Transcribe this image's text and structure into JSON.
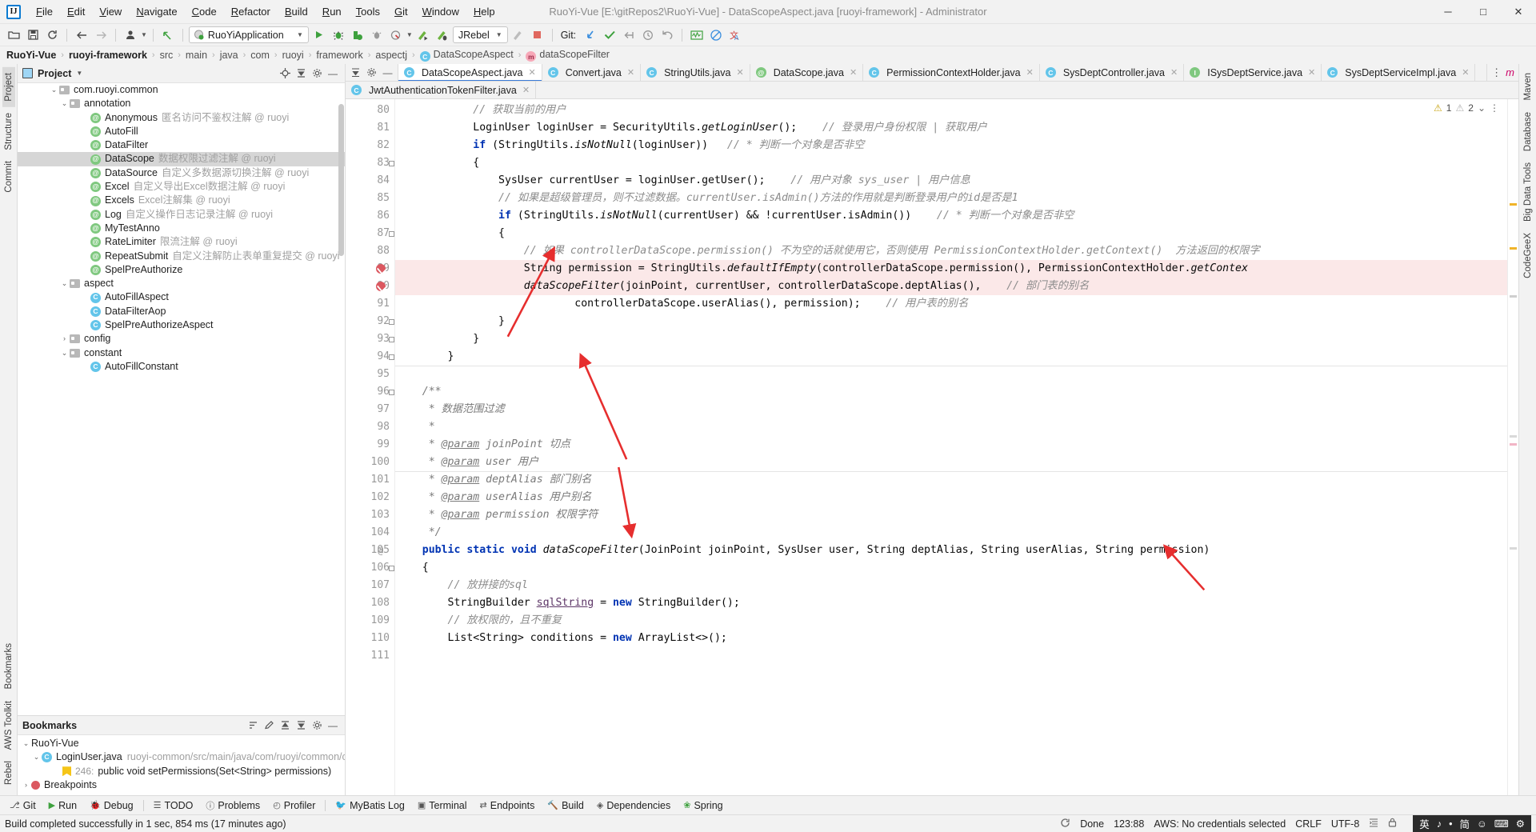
{
  "window": {
    "title": "RuoYi-Vue [E:\\gitRepos2\\RuoYi-Vue] - DataScopeAspect.java [ruoyi-framework] - Administrator",
    "minimize": "─",
    "maximize": "□",
    "close": "✕"
  },
  "menu": [
    "File",
    "Edit",
    "View",
    "Navigate",
    "Code",
    "Refactor",
    "Build",
    "Run",
    "Tools",
    "Git",
    "Window",
    "Help"
  ],
  "toolbar": {
    "open_label": "open-folder-icon",
    "save_label": "save-icon",
    "sync_label": "sync-icon",
    "back_label": "back-arrow-icon",
    "forward_label": "forward-arrow-icon",
    "profile_label": "user-icon",
    "undo_label": "undo-icon",
    "run_config": "RuoYiApplication",
    "run_label": "run-icon",
    "debug_label": "debug-icon",
    "run_coverage_label": "run-with-coverage-icon",
    "profiler_label": "profiler-icon",
    "attach_label": "attach-icon",
    "jrebel_run": "jrebel-run-icon",
    "jrebel_debug": "jrebel-debug-icon",
    "jrebel": "JRebel",
    "stop_label": "stop-icon",
    "git_label": "Git:",
    "git_update": "git-update-icon",
    "git_commit": "git-commit-icon",
    "git_push": "git-push-icon",
    "git_history": "git-history-icon",
    "git_rollback": "git-rollback-icon",
    "search_everywhere": "search-icon",
    "settings": "gear-icon",
    "translate": "translate-icon",
    "inspect": "inspect-icon",
    "layout": "layout-icon"
  },
  "breadcrumb": [
    {
      "label": "RuoYi-Vue",
      "bold": true,
      "icon": null
    },
    {
      "label": "ruoyi-framework",
      "bold": true,
      "icon": null
    },
    {
      "label": "src",
      "bold": false,
      "icon": null
    },
    {
      "label": "main",
      "bold": false,
      "icon": null
    },
    {
      "label": "java",
      "bold": false,
      "icon": null
    },
    {
      "label": "com",
      "bold": false,
      "icon": null
    },
    {
      "label": "ruoyi",
      "bold": false,
      "icon": null
    },
    {
      "label": "framework",
      "bold": false,
      "icon": null
    },
    {
      "label": "aspectj",
      "bold": false,
      "icon": null
    },
    {
      "label": "DataScopeAspect",
      "bold": false,
      "icon": "class"
    },
    {
      "label": "dataScopeFilter",
      "bold": false,
      "icon": "method"
    }
  ],
  "left_strip": [
    {
      "label": "Project",
      "selected": true
    },
    {
      "label": "Structure",
      "selected": false
    },
    {
      "label": "Commit",
      "selected": false
    }
  ],
  "left_strip_bottom": [
    {
      "label": "Bookmarks"
    },
    {
      "label": "AWS Toolkit"
    },
    {
      "label": "Rebel"
    }
  ],
  "right_strip": [
    {
      "label": "Maven"
    },
    {
      "label": "Database"
    },
    {
      "label": "Big Data Tools"
    },
    {
      "label": "CodeGeeX"
    }
  ],
  "project_panel": {
    "title": "Project",
    "title_icon": "project-icon",
    "actions": [
      "locate-icon",
      "collapse-all-icon",
      "settings-icon",
      "hide-icon"
    ],
    "tree": [
      {
        "indent": 3,
        "arrow": "down",
        "icon": "folder",
        "name": "com.ruoyi.common",
        "desc": "",
        "selected": false
      },
      {
        "indent": 4,
        "arrow": "down",
        "icon": "folder",
        "name": "annotation",
        "desc": "",
        "selected": false
      },
      {
        "indent": 6,
        "arrow": "none",
        "icon": "ann",
        "name": "Anonymous",
        "desc": "匿名访问不鉴权注解 @ ruoyi",
        "selected": false
      },
      {
        "indent": 6,
        "arrow": "none",
        "icon": "ann",
        "name": "AutoFill",
        "desc": "",
        "selected": false
      },
      {
        "indent": 6,
        "arrow": "none",
        "icon": "ann",
        "name": "DataFilter",
        "desc": "",
        "selected": false
      },
      {
        "indent": 6,
        "arrow": "none",
        "icon": "ann",
        "name": "DataScope",
        "desc": "数据权限过滤注解 @ ruoyi",
        "selected": true
      },
      {
        "indent": 6,
        "arrow": "none",
        "icon": "ann",
        "name": "DataSource",
        "desc": "自定义多数据源切换注解 @ ruoyi",
        "selected": false
      },
      {
        "indent": 6,
        "arrow": "none",
        "icon": "ann",
        "name": "Excel",
        "desc": "自定义导出Excel数据注解 @ ruoyi",
        "selected": false
      },
      {
        "indent": 6,
        "arrow": "none",
        "icon": "ann",
        "name": "Excels",
        "desc": "Excel注解集 @ ruoyi",
        "selected": false
      },
      {
        "indent": 6,
        "arrow": "none",
        "icon": "ann",
        "name": "Log",
        "desc": "自定义操作日志记录注解 @ ruoyi",
        "selected": false
      },
      {
        "indent": 6,
        "arrow": "none",
        "icon": "ann",
        "name": "MyTestAnno",
        "desc": "",
        "selected": false
      },
      {
        "indent": 6,
        "arrow": "none",
        "icon": "ann",
        "name": "RateLimiter",
        "desc": "限流注解 @ ruoyi",
        "selected": false
      },
      {
        "indent": 6,
        "arrow": "none",
        "icon": "ann",
        "name": "RepeatSubmit",
        "desc": "自定义注解防止表单重复提交 @ ruoyi",
        "selected": false
      },
      {
        "indent": 6,
        "arrow": "none",
        "icon": "ann",
        "name": "SpelPreAuthorize",
        "desc": "",
        "selected": false
      },
      {
        "indent": 4,
        "arrow": "down",
        "icon": "folder",
        "name": "aspect",
        "desc": "",
        "selected": false
      },
      {
        "indent": 6,
        "arrow": "none",
        "icon": "class",
        "name": "AutoFillAspect",
        "desc": "",
        "selected": false
      },
      {
        "indent": 6,
        "arrow": "none",
        "icon": "class",
        "name": "DataFilterAop",
        "desc": "",
        "selected": false
      },
      {
        "indent": 6,
        "arrow": "none",
        "icon": "class",
        "name": "SpelPreAuthorizeAspect",
        "desc": "",
        "selected": false
      },
      {
        "indent": 4,
        "arrow": "right",
        "icon": "folder",
        "name": "config",
        "desc": "",
        "selected": false
      },
      {
        "indent": 4,
        "arrow": "down",
        "icon": "folder",
        "name": "constant",
        "desc": "",
        "selected": false
      },
      {
        "indent": 6,
        "arrow": "none",
        "icon": "class",
        "name": "AutoFillConstant",
        "desc": "",
        "selected": false
      }
    ]
  },
  "bookmarks_panel": {
    "title": "Bookmarks",
    "actions": [
      "sort-icon",
      "edit-icon",
      "expand-all-icon",
      "collapse-all-icon",
      "settings-icon",
      "hide-icon"
    ],
    "rows": [
      {
        "indent": 0,
        "arrow": "down",
        "icon": "none",
        "name": "RuoYi-Vue",
        "desc": "",
        "num": ""
      },
      {
        "indent": 1,
        "arrow": "down",
        "icon": "class",
        "name": "LoginUser.java",
        "desc": "ruoyi-common/src/main/java/com/ruoyi/common/core/do",
        "num": ""
      },
      {
        "indent": 3,
        "arrow": "none",
        "icon": "bookmark",
        "name": "public void setPermissions(Set<String> permissions)",
        "desc": "",
        "num": "246:"
      },
      {
        "indent": 0,
        "arrow": "right",
        "icon": "breakpoint",
        "name": "Breakpoints",
        "desc": "",
        "num": ""
      }
    ]
  },
  "editor_tabs": [
    {
      "label": "DataScopeAspect.java",
      "icon": "class",
      "active": true
    },
    {
      "label": "Convert.java",
      "icon": "class",
      "active": false
    },
    {
      "label": "StringUtils.java",
      "icon": "class",
      "active": false
    },
    {
      "label": "DataScope.java",
      "icon": "ann",
      "active": false
    },
    {
      "label": "PermissionContextHolder.java",
      "icon": "class",
      "active": false
    },
    {
      "label": "SysDeptController.java",
      "icon": "class",
      "active": false
    },
    {
      "label": "ISysDeptService.java",
      "icon": "iface",
      "active": false
    },
    {
      "label": "SysDeptServiceImpl.java",
      "icon": "class",
      "active": false
    }
  ],
  "editor_tabs_row2": [
    {
      "label": "JwtAuthenticationTokenFilter.java",
      "icon": "class",
      "active": false
    }
  ],
  "inspection": {
    "warnings_icon": "warning-icon",
    "warnings": "1",
    "weak_icon": "weak-warning-icon",
    "weak": "2",
    "chevron": "⌄",
    "more": "⋮"
  },
  "editor": {
    "first_line": 80,
    "lines": [
      {
        "n": 80,
        "html": "            <span class='cm'>// 获取当前的用户</span>",
        "bp": false,
        "fold": false,
        "hl": false,
        "at": false
      },
      {
        "n": 81,
        "html": "            LoginUser loginUser = SecurityUtils.<span class='mthi'>getLoginUser</span>();    <span class='cm'>// 登录用户身份权限 | 获取用户</span>",
        "bp": false,
        "fold": false,
        "hl": false,
        "at": false
      },
      {
        "n": 82,
        "html": "            <span class='kw'>if</span> (StringUtils.<span class='mthi'>isNotNull</span>(loginUser))   <span class='cm'>// * 判断一个对象是否非空</span>",
        "bp": false,
        "fold": false,
        "hl": false,
        "at": false
      },
      {
        "n": 83,
        "html": "            {",
        "bp": false,
        "fold": true,
        "hl": false,
        "at": false
      },
      {
        "n": 84,
        "html": "                SysUser currentUser = loginUser.getUser();    <span class='cm'>// 用户对象 sys_user | 用户信息</span>",
        "bp": false,
        "fold": false,
        "hl": false,
        "at": false
      },
      {
        "n": 85,
        "html": "                <span class='cm'>// 如果是超级管理员，则不过滤数据。currentUser.isAdmin()方法的作用就是判断登录用户的id是否是1</span>",
        "bp": false,
        "fold": false,
        "hl": false,
        "at": false
      },
      {
        "n": 86,
        "html": "                <span class='kw'>if</span> (StringUtils.<span class='mthi'>isNotNull</span>(currentUser) &amp;&amp; !currentUser.isAdmin())    <span class='cm'>// * 判断一个对象是否非空</span>",
        "bp": false,
        "fold": false,
        "hl": false,
        "at": false
      },
      {
        "n": 87,
        "html": "                {",
        "bp": false,
        "fold": true,
        "hl": false,
        "at": false
      },
      {
        "n": 88,
        "html": "                    <span class='cm'>// 如果 controllerDataScope.permission() 不为空的话就使用它，否则使用 PermissionContextHolder.getContext()  方法返回的权限字</span>",
        "bp": false,
        "fold": false,
        "hl": false,
        "at": false
      },
      {
        "n": 89,
        "html": "                    String permission = StringUtils.<span class='mthi'>defaultIfEmpty</span>(controllerDataScope.permission(), PermissionContextHolder.<span class='mthi'>getContex</span>",
        "bp": true,
        "fold": false,
        "hl": true,
        "at": false
      },
      {
        "n": 90,
        "html": "                    <span class='mthi'>dataScopeFilter</span>(joinPoint, currentUser, controllerDataScope.deptAlias(),    <span class='cm'>// 部门表的别名</span>",
        "bp": true,
        "fold": false,
        "hl": true,
        "at": false
      },
      {
        "n": 91,
        "html": "                            controllerDataScope.userAlias(), permission);    <span class='cm'>// 用户表的别名</span>",
        "bp": false,
        "fold": false,
        "hl": false,
        "at": false
      },
      {
        "n": 92,
        "html": "                }",
        "bp": false,
        "fold": true,
        "hl": false,
        "at": false
      },
      {
        "n": 93,
        "html": "            }",
        "bp": false,
        "fold": true,
        "hl": false,
        "at": false
      },
      {
        "n": 94,
        "html": "        }",
        "bp": false,
        "fold": true,
        "hl": false,
        "at": false
      },
      {
        "n": 95,
        "html": "",
        "bp": false,
        "fold": false,
        "hl": false,
        "at": false
      },
      {
        "n": 96,
        "html": "    <span class='jd'>/**</span>",
        "bp": false,
        "fold": true,
        "hl": false,
        "at": false
      },
      {
        "n": 97,
        "html": "     <span class='jd'>* 数据范围过滤</span>",
        "bp": false,
        "fold": false,
        "hl": false,
        "at": false
      },
      {
        "n": 98,
        "html": "     <span class='jd'>*</span>",
        "bp": false,
        "fold": false,
        "hl": false,
        "at": false
      },
      {
        "n": 99,
        "html": "     <span class='jd'>* <span class='jdtag'>@param</span> joinPoint 切点</span>",
        "bp": false,
        "fold": false,
        "hl": false,
        "at": false
      },
      {
        "n": 100,
        "html": "     <span class='jd'>* <span class='jdtag'>@param</span> user 用户</span>",
        "bp": false,
        "fold": false,
        "hl": false,
        "at": false
      },
      {
        "n": 101,
        "html": "     <span class='jd'>* <span class='jdtag'>@param</span> deptAlias 部门别名</span>",
        "bp": false,
        "fold": false,
        "hl": false,
        "at": false
      },
      {
        "n": 102,
        "html": "     <span class='jd'>* <span class='jdtag'>@param</span> userAlias 用户别名</span>",
        "bp": false,
        "fold": false,
        "hl": false,
        "at": false
      },
      {
        "n": 103,
        "html": "     <span class='jd'>* <span class='jdtag'>@param</span> permission 权限字符</span>",
        "bp": false,
        "fold": false,
        "hl": false,
        "at": false
      },
      {
        "n": 104,
        "html": "     <span class='jd'>*/</span>",
        "bp": false,
        "fold": false,
        "hl": false,
        "at": false
      },
      {
        "n": 105,
        "html": "    <span class='kw'>public</span> <span class='kw'>static</span> <span class='kw'>void</span> <span class='mthi'>dataScopeFilter</span>(JoinPoint joinPoint, SysUser user, String deptAlias, String userAlias, String permission)",
        "bp": false,
        "fold": false,
        "hl": false,
        "at": true
      },
      {
        "n": 106,
        "html": "    {",
        "bp": false,
        "fold": true,
        "hl": false,
        "at": false
      },
      {
        "n": 107,
        "html": "        <span class='cm'>// 放拼接的sql</span>",
        "bp": false,
        "fold": false,
        "hl": false,
        "at": false
      },
      {
        "n": 108,
        "html": "        StringBuilder <span class='fld'>sqlString</span> = <span class='kw'>new</span> StringBuilder();",
        "bp": false,
        "fold": false,
        "hl": false,
        "at": false
      },
      {
        "n": 109,
        "html": "        <span class='cm'>// 放权限的，且不重复</span>",
        "bp": false,
        "fold": false,
        "hl": false,
        "at": false
      },
      {
        "n": 110,
        "html": "        List&lt;String&gt; conditions = <span class='kw'>new</span> ArrayList&lt;&gt;();",
        "bp": false,
        "fold": false,
        "hl": false,
        "at": false
      },
      {
        "n": 111,
        "html": "",
        "bp": false,
        "fold": false,
        "hl": false,
        "at": false
      }
    ]
  },
  "bottom_bar": [
    {
      "label": "Git",
      "icon": "git-icon"
    },
    {
      "label": "Run",
      "icon": "run-icon"
    },
    {
      "label": "Debug",
      "icon": "debug-icon"
    },
    {
      "label": "TODO",
      "icon": "todo-icon"
    },
    {
      "label": "Problems",
      "icon": "problems-icon"
    },
    {
      "label": "Profiler",
      "icon": "profiler-icon"
    },
    {
      "label": "MyBatis Log",
      "icon": "mybatis-icon"
    },
    {
      "label": "Terminal",
      "icon": "terminal-icon"
    },
    {
      "label": "Endpoints",
      "icon": "endpoints-icon"
    },
    {
      "label": "Build",
      "icon": "build-icon"
    },
    {
      "label": "Dependencies",
      "icon": "dependencies-icon"
    },
    {
      "label": "Spring",
      "icon": "spring-icon"
    }
  ],
  "status_bar": {
    "message": "Build completed successfully in 1 sec, 854 ms (17 minutes ago)",
    "sync_icon": "sync-icon",
    "done": "Done",
    "position": "123:88",
    "aws": "AWS: No credentials selected",
    "line_sep": "CRLF",
    "encoding": "UTF-8",
    "indent_icon": "indent-icon",
    "lock_icon": "lock-icon",
    "ime": [
      "英",
      "♪",
      "•",
      "简",
      "☺",
      "⌨",
      "⚙"
    ]
  },
  "colors": {
    "accent": "#3b7cd8",
    "highlight_line": "#fbe8e8",
    "breakpoint": "#db5860",
    "keyword": "#0033b3",
    "comment": "#8c8c8c",
    "arrow_red": "#e03030",
    "selection": "#d6d6d6"
  }
}
